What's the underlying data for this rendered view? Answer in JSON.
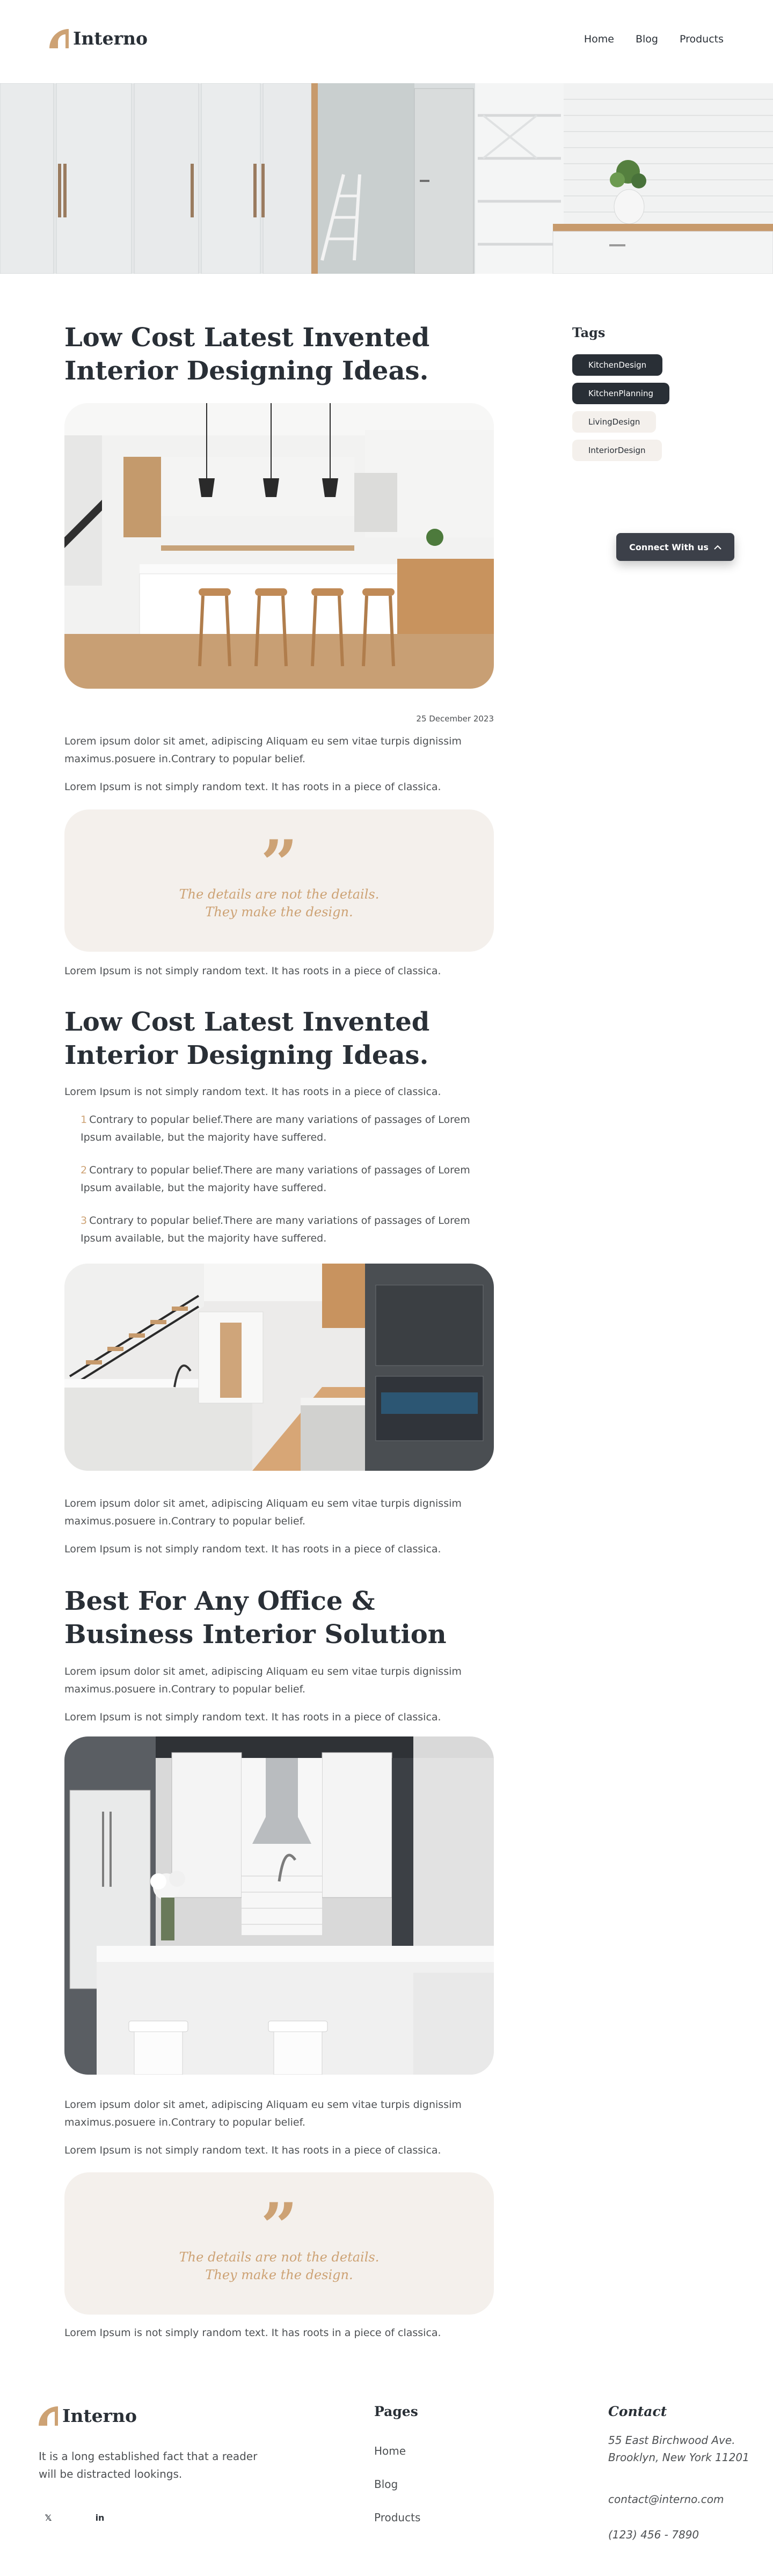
{
  "header": {
    "logo_text": "Interno",
    "nav": [
      {
        "label": "Home"
      },
      {
        "label": "Blog"
      },
      {
        "label": "Products"
      }
    ]
  },
  "article": {
    "title_1": "Low Cost Latest Invented Interior Designing Ideas.",
    "date": "25 December 2023",
    "para_1": "Lorem ipsum dolor sit amet, adipiscing Aliquam eu sem vitae turpis dignissim maximus.posuere in.Contrary to popular belief.",
    "para_2": "Lorem Ipsum is not simply random text. It has roots in a piece of classica.",
    "quote_1": {
      "mark": "”",
      "line1": "The details are not the details.",
      "line2": "They make the design."
    },
    "para_3": "Lorem Ipsum is not simply random text. It has roots in a piece of classica.",
    "title_2": "Low Cost Latest Invented Interior Designing Ideas.",
    "para_4": "Lorem Ipsum is not simply random text. It has roots in a piece of classica.",
    "list": [
      {
        "num": "1",
        "text": "Contrary to popular belief.There are many variations of passages of Lorem Ipsum available, but the majority have suffered."
      },
      {
        "num": "2",
        "text": "Contrary to popular belief.There are many variations of passages of Lorem Ipsum available, but the majority have suffered."
      },
      {
        "num": "3",
        "text": "Contrary to popular belief.There are many variations of passages of Lorem Ipsum available, but the majority have suffered."
      }
    ],
    "para_5": "Lorem ipsum dolor sit amet, adipiscing Aliquam eu sem vitae turpis dignissim maximus.posuere in.Contrary to popular belief.",
    "para_6": "Lorem Ipsum is not simply random text. It has roots in a piece of classica.",
    "title_3": "Best For Any Office & Business Interior Solution",
    "para_7": "Lorem ipsum dolor sit amet, adipiscing Aliquam eu sem vitae turpis dignissim maximus.posuere in.Contrary to popular belief.",
    "para_8": "Lorem Ipsum is not simply random text. It has roots in a piece of classica.",
    "para_9": "Lorem ipsum dolor sit amet, adipiscing Aliquam eu sem vitae turpis dignissim maximus.posuere in.Contrary to popular belief.",
    "para_10": "Lorem Ipsum is not simply random text. It has roots in a piece of classica.",
    "quote_2": {
      "mark": "”",
      "line1": "The details are not the details.",
      "line2": "They make the design."
    },
    "para_11": "Lorem Ipsum is not simply random text. It has roots in a piece of classica."
  },
  "sidebar": {
    "tags_title": "Tags",
    "tags": [
      {
        "label": "KitchenDesign"
      },
      {
        "label": "KitchenPlanning"
      },
      {
        "label": "LivingDesign"
      },
      {
        "label": "InteriorDesign"
      }
    ],
    "connect_label": "Connect With us",
    "connect_icon": "chevron-up-icon"
  },
  "footer": {
    "logo_text": "Interno",
    "about": "It is a long established fact that a reader will be distracted lookings.",
    "social": [
      {
        "icon": "twitter-icon",
        "glyph": "𝕏"
      },
      {
        "icon": "linkedin-icon",
        "glyph": "in"
      }
    ],
    "pages_title": "Pages",
    "pages": [
      {
        "label": "Home"
      },
      {
        "label": "Blog"
      },
      {
        "label": "Products"
      }
    ],
    "contact_title": "Contact",
    "address": "55 East Birchwood Ave. Brooklyn, New York 11201",
    "email": "contact@interno.com",
    "phone": "(123) 456 - 7890"
  },
  "colors": {
    "accent": "#cda274",
    "dark": "#292f36",
    "text": "#4d5053",
    "soft_bg": "#f4f0ec"
  }
}
